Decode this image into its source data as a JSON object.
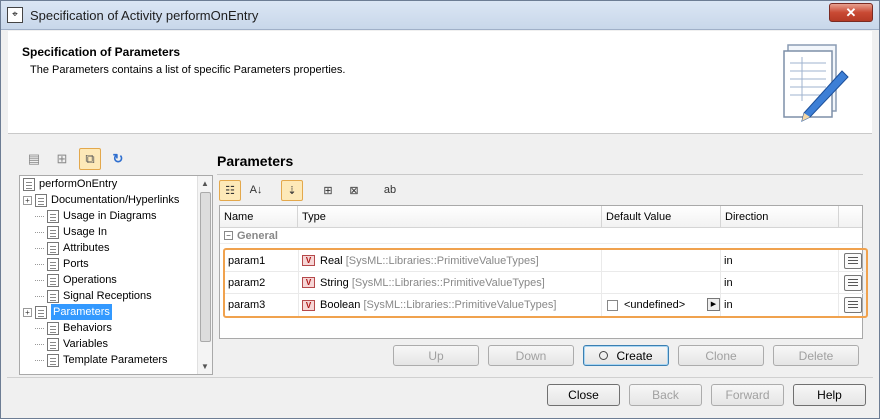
{
  "window": {
    "title": "Specification of Activity performOnEntry",
    "close_glyph": "✕"
  },
  "header": {
    "title": "Specification of Parameters",
    "description": "The Parameters contains a list of specific Parameters properties.",
    "icon": "document-pencil-icon"
  },
  "left_toolbar": {
    "icons": [
      "list-view-icon",
      "tree-view-icon",
      "toggle-icon",
      "refresh-icon"
    ]
  },
  "tree": {
    "root": "performOnEntry",
    "items": [
      {
        "label": "Documentation/Hyperlinks",
        "expandable": true
      },
      {
        "label": "Usage in Diagrams",
        "expandable": false
      },
      {
        "label": "Usage In",
        "expandable": false
      },
      {
        "label": "Attributes",
        "expandable": false
      },
      {
        "label": "Ports",
        "expandable": false
      },
      {
        "label": "Operations",
        "expandable": false
      },
      {
        "label": "Signal Receptions",
        "expandable": false
      },
      {
        "label": "Parameters",
        "expandable": true,
        "selected": true
      },
      {
        "label": "Behaviors",
        "expandable": false
      },
      {
        "label": "Variables",
        "expandable": false
      },
      {
        "label": "Template Parameters",
        "expandable": false
      }
    ]
  },
  "panel": {
    "title": "Parameters"
  },
  "grid": {
    "columns": [
      "Name",
      "Type",
      "Default Value",
      "Direction"
    ],
    "group": "General",
    "rows": [
      {
        "name": "param1",
        "type": "Real",
        "type_path": "[SysML::Libraries::PrimitiveValueTypes]",
        "default": "",
        "direction": "in"
      },
      {
        "name": "param2",
        "type": "String",
        "type_path": "[SysML::Libraries::PrimitiveValueTypes]",
        "default": "",
        "direction": "in"
      },
      {
        "name": "param3",
        "type": "Boolean",
        "type_path": "[SysML::Libraries::PrimitiveValueTypes]",
        "default": "<undefined>",
        "direction": "in"
      }
    ],
    "type_badge": "V"
  },
  "actions": {
    "up": "Up",
    "down": "Down",
    "create": "Create",
    "clone": "Clone",
    "delete": "Delete"
  },
  "footer": {
    "close": "Close",
    "back": "Back",
    "forward": "Forward",
    "help": "Help"
  },
  "colors": {
    "selection": "#3399ff",
    "highlight_border": "#f0a24e",
    "close_button": "#c94a34"
  }
}
